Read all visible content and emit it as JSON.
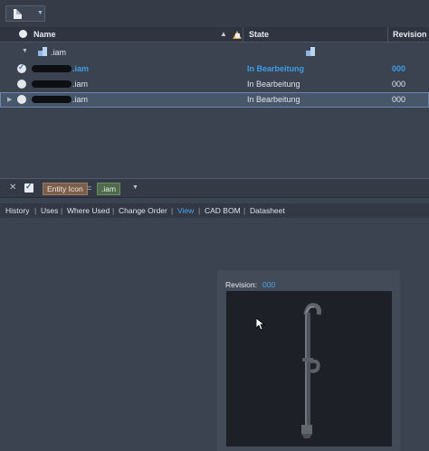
{
  "grid": {
    "columns": {
      "name": "Name",
      "state": "State",
      "revision": "Revision"
    },
    "group": {
      "label": ".iam"
    },
    "rows": [
      {
        "name_visible": ".iam",
        "state": "In Bearbeitung",
        "revision": "000"
      },
      {
        "name_visible": ".iam",
        "state": "In Bearbeitung",
        "revision": "000"
      },
      {
        "name_visible": ".iam",
        "state": "In Bearbeitung",
        "revision": "000"
      }
    ]
  },
  "filter": {
    "field": "Entity Icon",
    "operator": "=",
    "value": ".iam"
  },
  "tabs": [
    "History",
    "Uses",
    "Where Used",
    "Change Order",
    "View",
    "CAD BOM",
    "Datasheet"
  ],
  "active_tab": "View",
  "preview": {
    "revision_label": "Revision:",
    "revision_value": "000"
  },
  "colors": {
    "accent": "#4aa3e8",
    "background": "#3b4250",
    "viewport": "#1d2026"
  }
}
